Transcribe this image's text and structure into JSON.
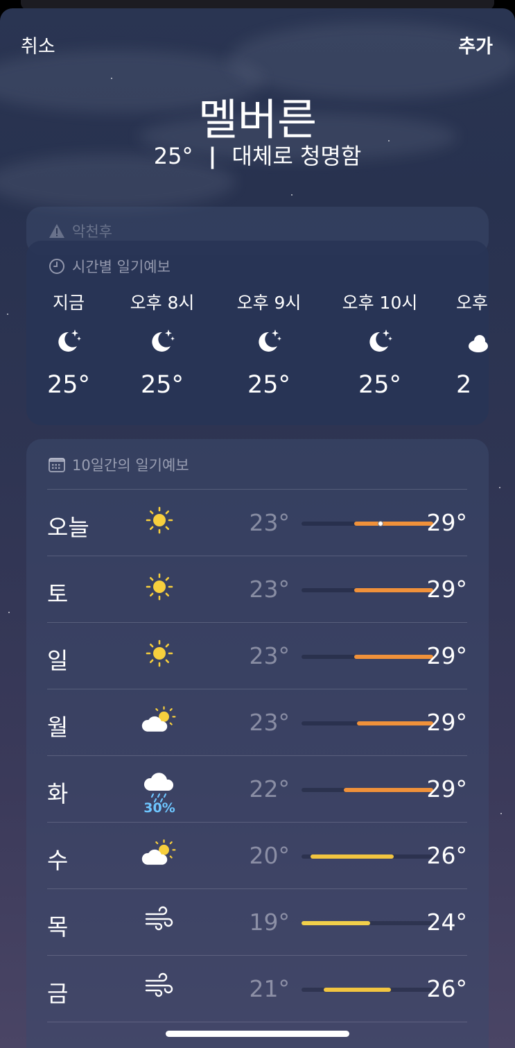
{
  "nav": {
    "cancel_label": "취소",
    "add_label": "추가"
  },
  "location": {
    "city": "멜버른",
    "current_temp": "25°",
    "separator": "|",
    "condition": "대체로 청명함"
  },
  "warning_card": {
    "title": "악천후",
    "icon": "warning-triangle-icon"
  },
  "hourly_card": {
    "title": "시간별 일기예보",
    "icon": "clock-icon",
    "hours": [
      {
        "label": "지금",
        "icon": "moon-stars-icon",
        "temp": "25°"
      },
      {
        "label": "오후 8시",
        "icon": "moon-stars-icon",
        "temp": "25°"
      },
      {
        "label": "오후 9시",
        "icon": "moon-stars-icon",
        "temp": "25°"
      },
      {
        "label": "오후 10시",
        "icon": "moon-stars-icon",
        "temp": "25°"
      },
      {
        "label": "오후",
        "icon": "cloud-moon-icon",
        "temp": "2"
      }
    ]
  },
  "daily_card": {
    "title": "10일간의 일기예보",
    "icon": "calendar-icon",
    "range_min": 19,
    "range_max": 29,
    "days": [
      {
        "day": "오늘",
        "icon": "sun-icon",
        "low": "23°",
        "high": "29°",
        "low_value": 23,
        "high_value": 29,
        "current_value": 25,
        "pop": "",
        "bar_color": "#f0913a"
      },
      {
        "day": "토",
        "icon": "sun-icon",
        "low": "23°",
        "high": "29°",
        "low_value": 23,
        "high_value": 29,
        "pop": "",
        "bar_color": "#f0913a"
      },
      {
        "day": "일",
        "icon": "sun-icon",
        "low": "23°",
        "high": "29°",
        "low_value": 23,
        "high_value": 29,
        "pop": "",
        "bar_color": "#f0913a"
      },
      {
        "day": "월",
        "icon": "partly-cloudy-icon",
        "low": "23°",
        "high": "29°",
        "low_value": 23.2,
        "high_value": 29,
        "pop": "",
        "bar_color": "#f0913a"
      },
      {
        "day": "화",
        "icon": "cloud-rain-icon",
        "low": "22°",
        "high": "29°",
        "low_value": 22.2,
        "high_value": 29,
        "pop": "30%",
        "bar_color": "#f0913a"
      },
      {
        "day": "수",
        "icon": "partly-cloudy-icon",
        "low": "20°",
        "high": "26°",
        "low_value": 19.7,
        "high_value": 26,
        "pop": "",
        "bar_color": "#f2c540"
      },
      {
        "day": "목",
        "icon": "wind-icon",
        "low": "19°",
        "high": "24°",
        "low_value": 19,
        "high_value": 24.2,
        "pop": "",
        "bar_color": "#f2d04a"
      },
      {
        "day": "금",
        "icon": "wind-icon",
        "low": "21°",
        "high": "26°",
        "low_value": 20.7,
        "high_value": 25.8,
        "pop": "",
        "bar_color": "#f2c540"
      }
    ]
  }
}
